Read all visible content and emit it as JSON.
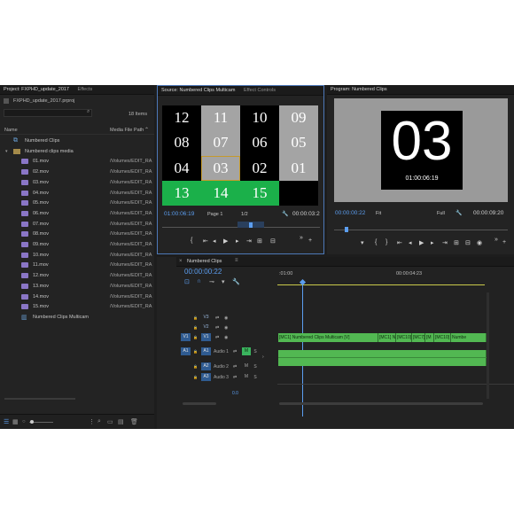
{
  "project": {
    "tab_project": "Project: FXPHD_update_2017",
    "tab_effects": "Effects",
    "file_name": "FXPHD_update_2017.prproj",
    "items_count": "18 Items",
    "col_name": "Name",
    "col_path": "Media File Path",
    "rows": [
      {
        "name": "Numbered Clips",
        "path": "",
        "type": "seq"
      },
      {
        "name": "Numbered clips media",
        "path": "",
        "type": "folder"
      },
      {
        "name": "01.mov",
        "path": "/Volumes/EDIT_RA",
        "type": "clip"
      },
      {
        "name": "02.mov",
        "path": "/Volumes/EDIT_RA",
        "type": "clip"
      },
      {
        "name": "03.mov",
        "path": "/Volumes/EDIT_RA",
        "type": "clip"
      },
      {
        "name": "04.mov",
        "path": "/Volumes/EDIT_RA",
        "type": "clip"
      },
      {
        "name": "05.mov",
        "path": "/Volumes/EDIT_RA",
        "type": "clip"
      },
      {
        "name": "06.mov",
        "path": "/Volumes/EDIT_RA",
        "type": "clip"
      },
      {
        "name": "07.mov",
        "path": "/Volumes/EDIT_RA",
        "type": "clip"
      },
      {
        "name": "08.mov",
        "path": "/Volumes/EDIT_RA",
        "type": "clip"
      },
      {
        "name": "09.mov",
        "path": "/Volumes/EDIT_RA",
        "type": "clip"
      },
      {
        "name": "10.mov",
        "path": "/Volumes/EDIT_RA",
        "type": "clip"
      },
      {
        "name": "11.mov",
        "path": "/Volumes/EDIT_RA",
        "type": "clip"
      },
      {
        "name": "12.mov",
        "path": "/Volumes/EDIT_RA",
        "type": "clip"
      },
      {
        "name": "13.mov",
        "path": "/Volumes/EDIT_RA",
        "type": "clip"
      },
      {
        "name": "14.mov",
        "path": "/Volumes/EDIT_RA",
        "type": "clip"
      },
      {
        "name": "15.mov",
        "path": "/Volumes/EDIT_RA",
        "type": "clip"
      },
      {
        "name": "Numbered Clips Multicam",
        "path": "",
        "type": "multicam"
      }
    ]
  },
  "source": {
    "tab_source": "Source: Numbered Clips Multicam",
    "tab_effect_controls": "Effect Controls",
    "grid": [
      [
        "12",
        "11",
        "10",
        "09"
      ],
      [
        "08",
        "07",
        "06",
        "05"
      ],
      [
        "04",
        "03",
        "02",
        "01"
      ],
      [
        "13",
        "14",
        "15",
        ""
      ]
    ],
    "timecode_in": "01:00:06:19",
    "page_label": "Page 1",
    "page_fraction": "1/2",
    "timecode_out": "00:00:03:2"
  },
  "program": {
    "tab_program": "Program: Numbered Clips",
    "big_number": "03",
    "overlay_timecode": "01:00:06:19",
    "timecode_in": "00:00:00:22",
    "fit_label": "Fit",
    "full_label": "Full",
    "timecode_out": "00:00:09:20"
  },
  "timeline": {
    "tab_label": "Numbered Clips",
    "timecode": "00:00:00:22",
    "ruler_start": ":01:00",
    "ruler_mid": "00:00:04:23",
    "tracks": [
      {
        "src": "",
        "id": "V3"
      },
      {
        "src": "",
        "id": "V2"
      },
      {
        "src": "V1",
        "id": "V1"
      },
      {
        "src": "A1",
        "id": "A1",
        "name": "Audio 1",
        "m": "M",
        "s": "S"
      },
      {
        "src": "",
        "id": "A2",
        "name": "Audio 2",
        "m": "M",
        "s": "S"
      },
      {
        "src": "",
        "id": "A3",
        "name": "Audio 3",
        "m": "M",
        "s": "S"
      }
    ],
    "video_clip_labels": [
      "[MC1] Numbered Clips Multicam [V]",
      "[MC1] Numb",
      "[MC10]",
      "[MC7]",
      "[M",
      "[MC10]",
      "Numbe"
    ],
    "zero_db": "0.0"
  },
  "colors": {
    "accent_blue": "#5c9ef0",
    "clip_green": "#52b852",
    "green_cell": "#1bb04a",
    "gray_cell": "#a4a4a4",
    "purple_icon": "#8a76c6"
  }
}
